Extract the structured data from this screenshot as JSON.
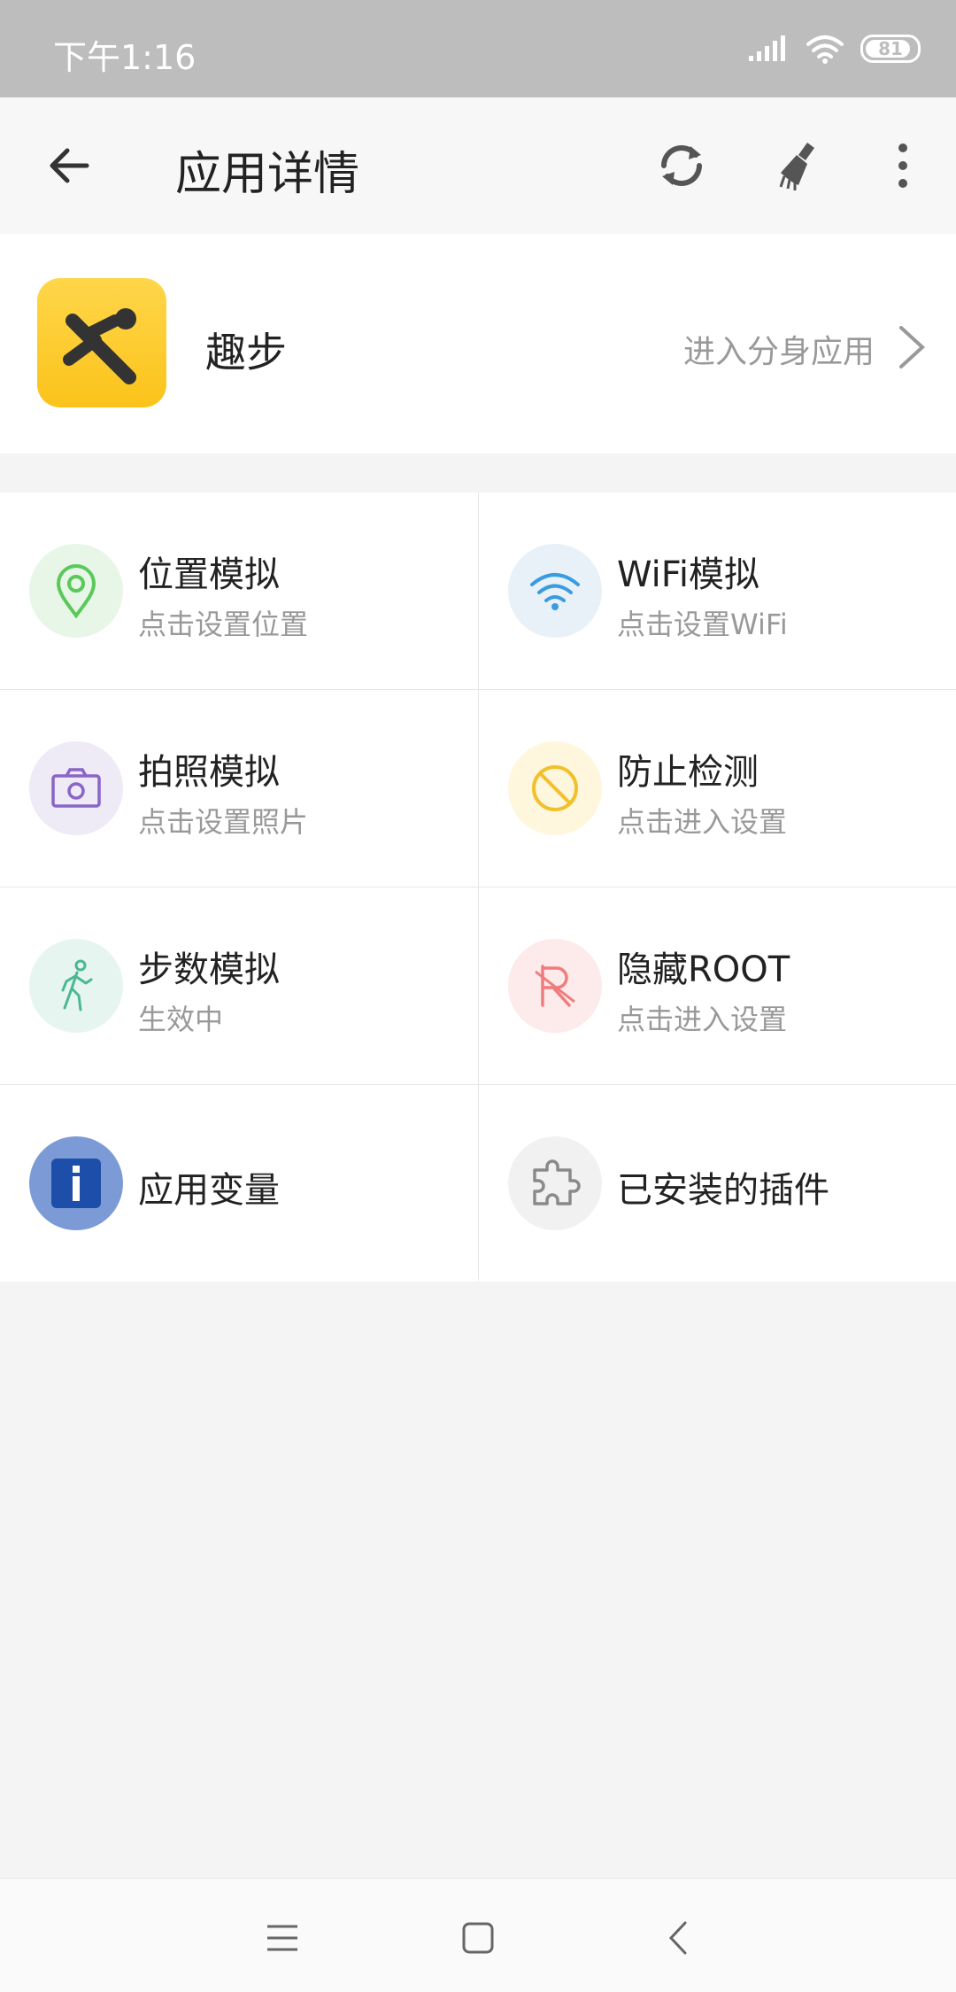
{
  "status_bar": {
    "time": "下午1:16",
    "battery": "81"
  },
  "toolbar": {
    "title": "应用详情"
  },
  "app": {
    "name": "趣步",
    "enter_clone": "进入分身应用"
  },
  "features": [
    {
      "title": "位置模拟",
      "subtitle": "点击设置位置",
      "icon": "location-pin-icon",
      "color": "#5ac85a",
      "bg": "#e8f6e8"
    },
    {
      "title": "WiFi模拟",
      "subtitle": "点击设置WiFi",
      "icon": "wifi-icon",
      "color": "#3a9be0",
      "bg": "#e9f1f8"
    },
    {
      "title": "拍照模拟",
      "subtitle": "点击设置照片",
      "icon": "camera-icon",
      "color": "#8a64c8",
      "bg": "#eeeaf6"
    },
    {
      "title": "防止检测",
      "subtitle": "点击进入设置",
      "icon": "block-icon",
      "color": "#f2c02a",
      "bg": "#fff6de"
    },
    {
      "title": "步数模拟",
      "subtitle": "生效中",
      "icon": "walking-icon",
      "color": "#4bb893",
      "bg": "#e6f5ef"
    },
    {
      "title": "隐藏ROOT",
      "subtitle": "点击进入设置",
      "icon": "no-root-icon",
      "color": "#ef7d7d",
      "bg": "#fdeaea"
    },
    {
      "title": "应用变量",
      "subtitle": "",
      "icon": "info-icon",
      "color": "#1d4faa",
      "bg": "#7c9bd6"
    },
    {
      "title": "已安装的插件",
      "subtitle": "",
      "icon": "puzzle-icon",
      "color": "#8a8a8a",
      "bg": "#f1f1f1"
    }
  ]
}
